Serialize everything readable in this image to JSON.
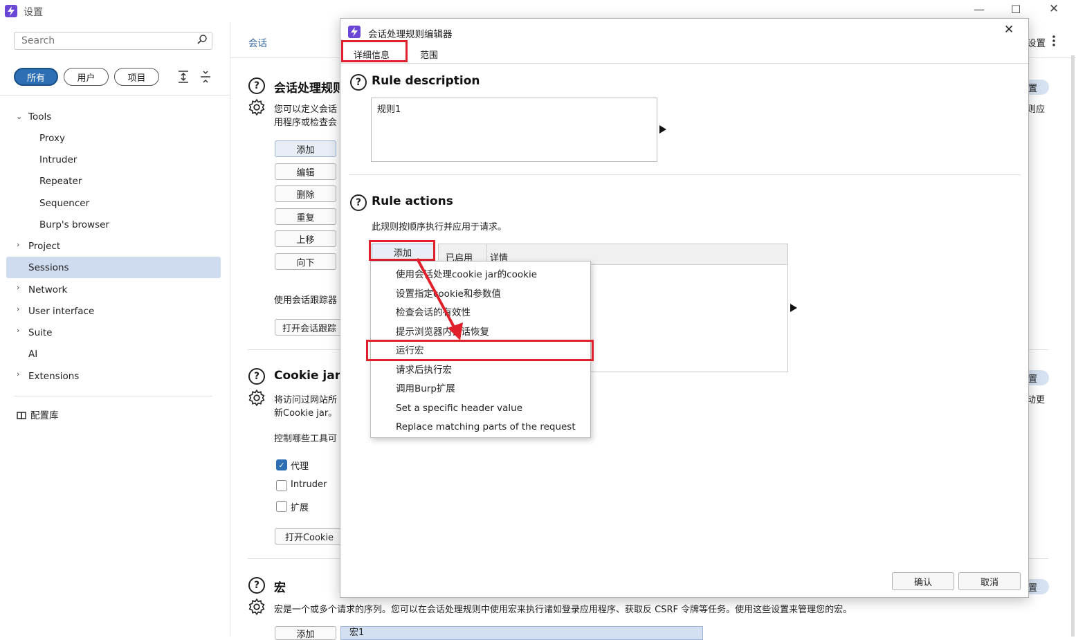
{
  "window": {
    "title": "设置",
    "minimize": "—",
    "maximize": "☐",
    "close": "✕"
  },
  "sidebar": {
    "search_placeholder": "Search",
    "filters": [
      "所有",
      "用户",
      "项目"
    ],
    "tree": [
      {
        "label": "Tools",
        "expanded": true
      },
      {
        "label": "Proxy"
      },
      {
        "label": "Intruder"
      },
      {
        "label": "Repeater"
      },
      {
        "label": "Sequencer"
      },
      {
        "label": "Burp's browser"
      },
      {
        "label": "Project"
      },
      {
        "label": "Sessions",
        "selected": true
      },
      {
        "label": "Network"
      },
      {
        "label": "User interface"
      },
      {
        "label": "Suite"
      },
      {
        "label": "AI"
      },
      {
        "label": "Extensions"
      }
    ],
    "library": "配置库"
  },
  "main": {
    "breadcrumb": "会话",
    "header_right": "设置",
    "session_rules": {
      "title": "会话处理规则",
      "desc_line1": "您可以定义会话",
      "desc_line2": "用程序或检查会",
      "buttons": [
        "添加",
        "编辑",
        "删除",
        "重复",
        "上移",
        "向下"
      ],
      "tracker_text": "使用会话跟踪器",
      "tracker_button": "打开会话跟踪",
      "right_pill": "置",
      "right_text": "则应"
    },
    "cookie_jar": {
      "title": "Cookie jar",
      "desc_line1": "将访问过网站所",
      "desc_line2": "新Cookie jar。",
      "control_text": "控制哪些工具可",
      "checkboxes": [
        {
          "label": "代理",
          "checked": true
        },
        {
          "label": "Intruder",
          "checked": false
        },
        {
          "label": "扩展",
          "checked": false
        }
      ],
      "open_button": "打开Cookie",
      "right_pill": "置",
      "right_text": "动更"
    },
    "macros": {
      "title": "宏",
      "desc": "宏是一个或多个请求的序列。您可以在会话处理规则中使用宏来执行诸如登录应用程序、获取反 CSRF 令牌等任务。使用这些设置来管理您的宏。",
      "add_button": "添加",
      "first_macro": "宏1",
      "right_pill": "置"
    }
  },
  "dialog": {
    "title": "会话处理规则编辑器",
    "close": "✕",
    "tabs": [
      "详细信息",
      "范围"
    ],
    "rule_description": {
      "title": "Rule description",
      "value": "规则1"
    },
    "rule_actions": {
      "title": "Rule actions",
      "desc": "此规则按顺序执行并应用于请求。",
      "add_button": "添加",
      "columns": [
        "已启用",
        "详情"
      ]
    },
    "ok_button": "确认",
    "cancel_button": "取消"
  },
  "menu": {
    "items": [
      "使用会话处理cookie jar的cookie",
      "设置指定cookie和参数值",
      "检查会话的有效性",
      "提示浏览器内会话恢复",
      "运行宏",
      "请求后执行宏",
      "调用Burp扩展",
      "Set a specific header value",
      "Replace matching parts of the request"
    ],
    "highlighted_item": "运行宏"
  },
  "colors": {
    "accent": "#2d6fb4",
    "highlight": "#e0202a",
    "selected_bg": "#cfdcf0",
    "brand": "#6a46d6"
  }
}
